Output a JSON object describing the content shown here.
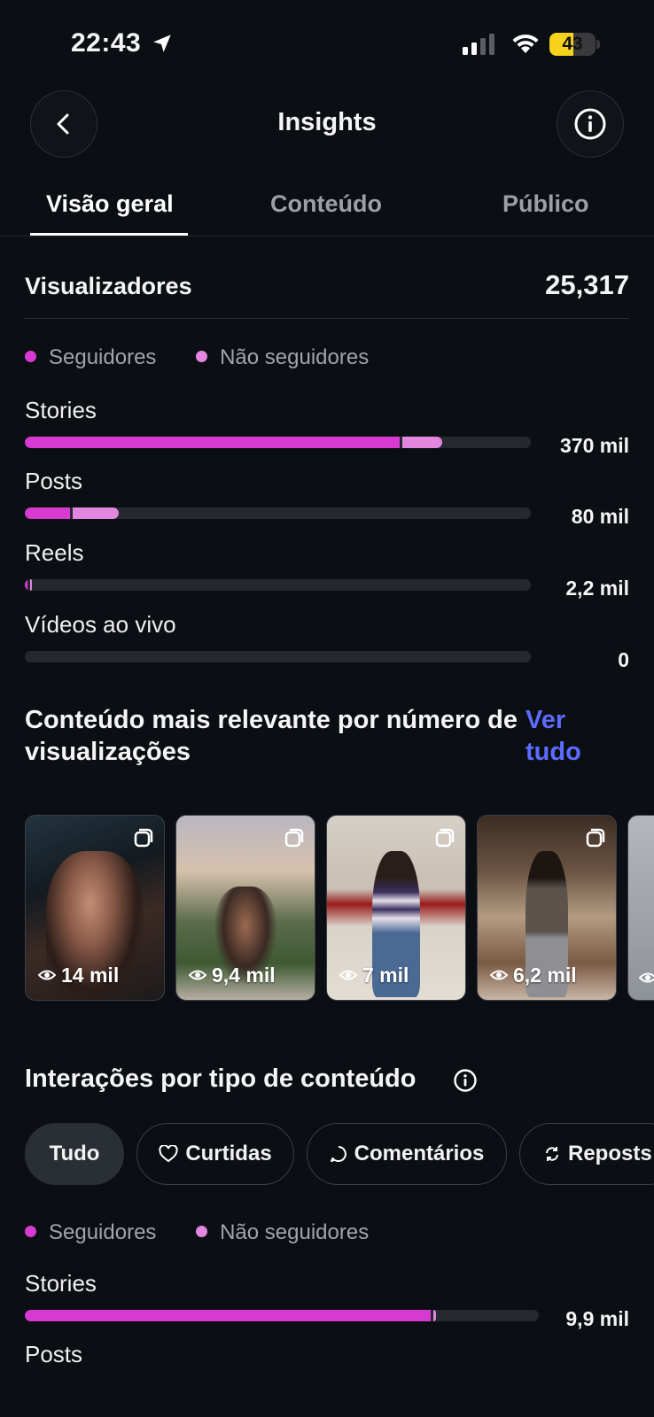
{
  "status_bar": {
    "time": "22:43",
    "battery": "43"
  },
  "nav": {
    "title": "Insights"
  },
  "tabs": [
    "Visão geral",
    "Conteúdo",
    "Público"
  ],
  "viewers": {
    "label": "Visualizadores",
    "value": "25,317",
    "legend": {
      "followers": "Seguidores",
      "non_followers": "Não seguidores"
    },
    "rows": [
      {
        "label": "Stories",
        "value": "370 mil",
        "followers_fraction": 0.74,
        "non_followers_fraction": 0.08
      },
      {
        "label": "Posts",
        "value": "80 mil",
        "followers_fraction": 0.09,
        "non_followers_fraction": 0.09
      },
      {
        "label": "Reels",
        "value": "2,2 mil",
        "followers_fraction": 0.005,
        "non_followers_fraction": 0.003
      },
      {
        "label": "Vídeos ao vivo",
        "value": "0",
        "followers_fraction": 0,
        "non_followers_fraction": 0
      }
    ]
  },
  "most_relevant": {
    "title": "Conteúdo mais relevante por número de visualizações",
    "see_all": "Ver tudo",
    "items": [
      {
        "views": "14 mil"
      },
      {
        "views": "9,4 mil"
      },
      {
        "views": "7 mil"
      },
      {
        "views": "6,2 mil"
      }
    ]
  },
  "interactions": {
    "title": "Interações por tipo de conteúdo",
    "filters": [
      "Tudo",
      "Curtidas",
      "Comentários",
      "Reposts"
    ],
    "legend": {
      "followers": "Seguidores",
      "non_followers": "Não seguidores"
    },
    "rows": [
      {
        "label": "Stories",
        "value": "9,9 mil",
        "followers_fraction": 0.79,
        "non_followers_fraction": 0.005
      },
      {
        "label": "Posts"
      }
    ]
  },
  "colors": {
    "followers": "#d63ad0",
    "non_followers": "#e386e0",
    "accent_link": "#5b6cff",
    "background": "#0b0e13"
  }
}
